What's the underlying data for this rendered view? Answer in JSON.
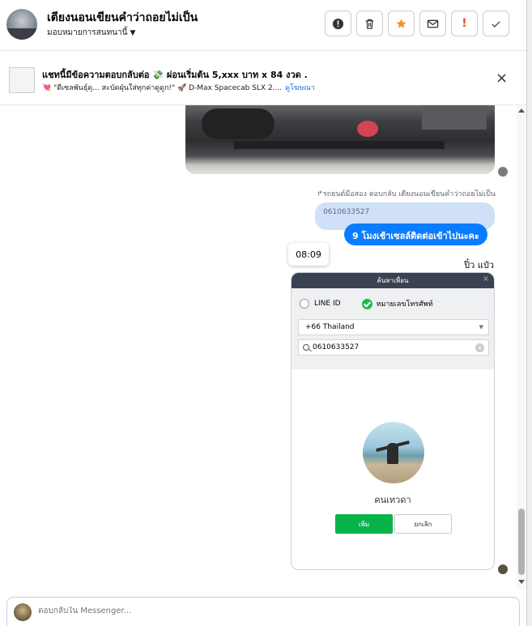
{
  "header": {
    "title": "เตียงนอนเขียนคำว่าถอยไม่เป็น",
    "subtitle": "มอบหมายการสนทนานี้",
    "actions": [
      {
        "icon": "alert-circle-icon",
        "label": "!"
      },
      {
        "icon": "trash-icon",
        "label": ""
      },
      {
        "icon": "star-icon",
        "label": "★"
      },
      {
        "icon": "envelope-icon",
        "label": ""
      },
      {
        "icon": "exclamation-icon",
        "label": "!"
      },
      {
        "icon": "check-icon",
        "label": "✓"
      }
    ],
    "accent_star": "#f0922b",
    "accent_exclaim": "#e0502a"
  },
  "ad": {
    "title": "แชทนี้มีข้อความตอบกลับต่อ 💸 ผ่อนเริ่มต้น 5,xxx บาท x 84 งวด .",
    "description": "💘 \"ดีเซลพันธุ์ดุ... สะบัดฝุ่นใส่ทุกค่าดูดูก!\" 🚀 D-Max Spacecab SLX 2....",
    "link": "ดูโฆษณา",
    "close": "×"
  },
  "chat": {
    "reply_note": "รถยนต์มือสอง ตอบกลับ เตียงนอนเขียนคำว่าถอยไม่เป็น",
    "quoted_text": "0610633527",
    "my_message": "9 โมงเช้าเซลล์ติดต่อเข้าไปนะคะ",
    "time_chip": "08:09",
    "sender_name": "ปิ๋ว แป๋ว",
    "bubble_color": "#0a7cff"
  },
  "screenshot": {
    "header": "ค้นหาเพื่อน",
    "close": "×",
    "option_line_id": "LINE ID",
    "option_phone": "หมายเลขโทรศัพท์",
    "country": "+66  Thailand",
    "search_value": "0610633527",
    "profile_name": "คนเทวดา",
    "add_button": "เพิ่ม",
    "cancel_button": "ยกเลิก"
  },
  "composer": {
    "placeholder": "ตอบกลับใน Messenger..."
  }
}
